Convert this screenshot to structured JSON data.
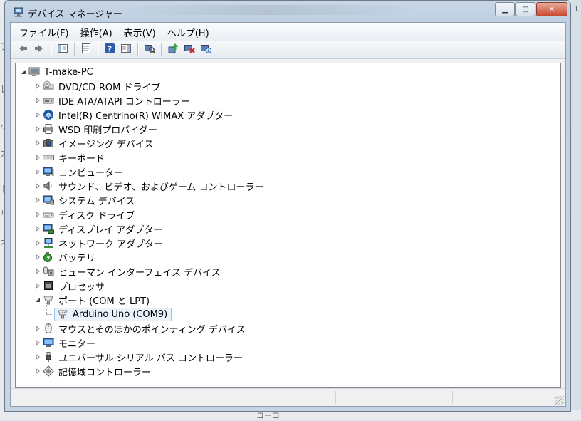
{
  "window": {
    "title": "デバイス マネージャー"
  },
  "menu": [
    {
      "label": "ファイル(F)"
    },
    {
      "label": "操作(A)"
    },
    {
      "label": "表示(V)"
    },
    {
      "label": "ヘルプ(H)"
    }
  ],
  "toolbar": [
    {
      "icon": "back-icon"
    },
    {
      "icon": "forward-icon"
    },
    {
      "sep": true
    },
    {
      "icon": "show-hide-tree-icon"
    },
    {
      "sep": true
    },
    {
      "icon": "properties-icon"
    },
    {
      "sep": true
    },
    {
      "icon": "help-icon"
    },
    {
      "icon": "show-action-pane-icon"
    },
    {
      "sep": true
    },
    {
      "icon": "scan-hardware-icon"
    },
    {
      "sep": true
    },
    {
      "icon": "update-driver-icon"
    },
    {
      "icon": "disable-device-icon"
    },
    {
      "icon": "uninstall-device-icon"
    }
  ],
  "tree": {
    "root": "T-make-PC",
    "items": [
      {
        "label": "DVD/CD-ROM ドライブ",
        "icon": "dvd-drive-icon"
      },
      {
        "label": "IDE ATA/ATAPI コントローラー",
        "icon": "ide-controller-icon"
      },
      {
        "label": "Intel(R) Centrino(R) WiMAX アダプター",
        "icon": "wimax-icon"
      },
      {
        "label": "WSD 印刷プロバイダー",
        "icon": "printer-icon"
      },
      {
        "label": "イメージング デバイス",
        "icon": "camera-icon"
      },
      {
        "label": "キーボード",
        "icon": "keyboard-icon"
      },
      {
        "label": "コンピューター",
        "icon": "computer-icon"
      },
      {
        "label": "サウンド、ビデオ、およびゲーム コントローラー",
        "icon": "speaker-icon"
      },
      {
        "label": "システム デバイス",
        "icon": "system-device-icon"
      },
      {
        "label": "ディスク ドライブ",
        "icon": "disk-drive-icon"
      },
      {
        "label": "ディスプレイ アダプター",
        "icon": "display-adapter-icon"
      },
      {
        "label": "ネットワーク アダプター",
        "icon": "network-adapter-icon"
      },
      {
        "label": "バッテリ",
        "icon": "battery-icon"
      },
      {
        "label": "ヒューマン インターフェイス デバイス",
        "icon": "hid-icon"
      },
      {
        "label": "プロセッサ",
        "icon": "processor-icon"
      },
      {
        "label": "ポート (COM と LPT)",
        "icon": "port-icon",
        "expanded": true
      },
      {
        "label": "Arduino Uno (COM9)",
        "icon": "port-icon",
        "child": true,
        "selected": true
      },
      {
        "label": "マウスとそのほかのポインティング デバイス",
        "icon": "mouse-icon"
      },
      {
        "label": "モニター",
        "icon": "monitor-icon"
      },
      {
        "label": "ユニバーサル シリアル バス コントローラー",
        "icon": "usb-icon"
      },
      {
        "label": "記憶域コントローラー",
        "icon": "storage-controller-icon"
      }
    ]
  },
  "background": {
    "left_glyphs": [
      "フ",
      "レ",
      "ポ",
      "カ",
      "ト",
      "リ",
      "オ"
    ],
    "right_glyph": "1",
    "bottom_text": "コーコ"
  }
}
